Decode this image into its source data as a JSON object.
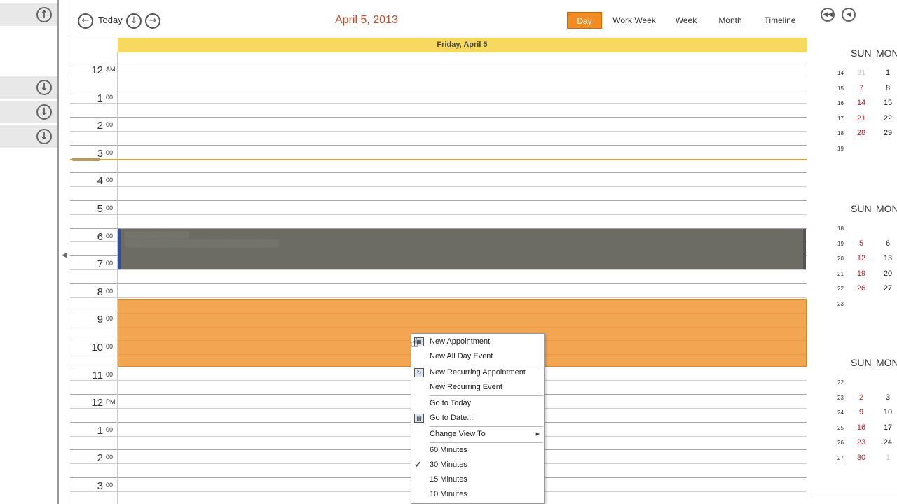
{
  "toolbar": {
    "today_label": "Today",
    "date_title": "April 5, 2013",
    "views": [
      "Day",
      "Work Week",
      "Week",
      "Month",
      "Timeline"
    ],
    "active_view": "Day"
  },
  "day_header": "Friday, April 5",
  "hours": [
    {
      "h": "12",
      "s": "AM"
    },
    {
      "h": "1",
      "s": "00"
    },
    {
      "h": "2",
      "s": "00"
    },
    {
      "h": "3",
      "s": "00"
    },
    {
      "h": "4",
      "s": "00"
    },
    {
      "h": "5",
      "s": "00"
    },
    {
      "h": "6",
      "s": "00"
    },
    {
      "h": "7",
      "s": "00"
    },
    {
      "h": "8",
      "s": "00"
    },
    {
      "h": "9",
      "s": "00"
    },
    {
      "h": "10",
      "s": "00"
    },
    {
      "h": "11",
      "s": "00"
    },
    {
      "h": "12",
      "s": "PM"
    },
    {
      "h": "1",
      "s": "00"
    },
    {
      "h": "2",
      "s": "00"
    },
    {
      "h": "3",
      "s": "00"
    }
  ],
  "context_menu": {
    "items": [
      {
        "label": "New Appointment",
        "icon": "calendar-icon"
      },
      {
        "label": "New All Day Event"
      },
      {
        "label": "New Recurring Appointment",
        "icon": "recurring-icon"
      },
      {
        "label": "New Recurring Event"
      },
      {
        "label": "Go to Today"
      },
      {
        "label": "Go to Date...",
        "icon": "goto-date-icon"
      },
      {
        "label": "Change View To",
        "submenu": true
      },
      {
        "label": "60 Minutes"
      },
      {
        "label": "30 Minutes",
        "checked": true
      },
      {
        "label": "15 Minutes"
      },
      {
        "label": "10 Minutes"
      }
    ]
  },
  "mini_calendars": [
    {
      "headers": [
        "SUN",
        "MON"
      ],
      "weeks": [
        {
          "wk": "14",
          "sun": "31",
          "sun_dim": true,
          "mon": "1"
        },
        {
          "wk": "15",
          "sun": "7",
          "mon": "8"
        },
        {
          "wk": "16",
          "sun": "14",
          "mon": "15"
        },
        {
          "wk": "17",
          "sun": "21",
          "mon": "22"
        },
        {
          "wk": "18",
          "sun": "28",
          "mon": "29"
        },
        {
          "wk": "19",
          "sun": "",
          "mon": ""
        }
      ]
    },
    {
      "headers": [
        "SUN",
        "MON"
      ],
      "weeks": [
        {
          "wk": "18",
          "sun": "",
          "mon": ""
        },
        {
          "wk": "19",
          "sun": "5",
          "mon": "6"
        },
        {
          "wk": "20",
          "sun": "12",
          "mon": "13"
        },
        {
          "wk": "21",
          "sun": "19",
          "mon": "20"
        },
        {
          "wk": "22",
          "sun": "26",
          "mon": "27"
        },
        {
          "wk": "23",
          "sun": "",
          "mon": ""
        }
      ]
    },
    {
      "headers": [
        "SUN",
        "MON"
      ],
      "weeks": [
        {
          "wk": "22",
          "sun": "",
          "mon": ""
        },
        {
          "wk": "23",
          "sun": "2",
          "mon": "3"
        },
        {
          "wk": "24",
          "sun": "9",
          "mon": "10"
        },
        {
          "wk": "25",
          "sun": "16",
          "mon": "17"
        },
        {
          "wk": "26",
          "sun": "23",
          "mon": "24"
        },
        {
          "wk": "27",
          "sun": "30",
          "mon": "1",
          "mon_dim": true
        }
      ]
    }
  ],
  "colors": {
    "accent": "#f08c21",
    "header_bar": "#f8d95f",
    "appointment_orange": "#f2a651",
    "appointment_gray": "#6c6c64",
    "date_title": "#b5502b",
    "sunday": "#b8232b"
  }
}
